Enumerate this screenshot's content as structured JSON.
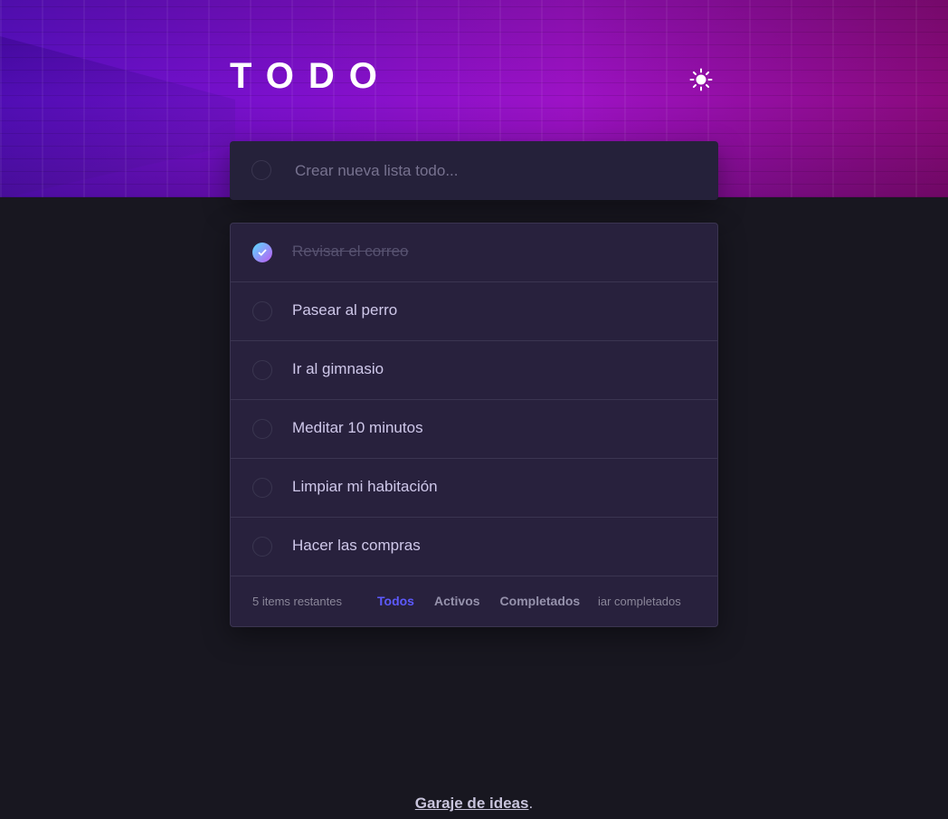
{
  "app": {
    "title": "TODO",
    "theme_icon": "sun-icon"
  },
  "new_todo": {
    "placeholder": "Crear nueva lista todo...",
    "value": ""
  },
  "todos": [
    {
      "label": "Revisar el correo",
      "completed": true
    },
    {
      "label": "Pasear al perro",
      "completed": false
    },
    {
      "label": "Ir al gimnasio",
      "completed": false
    },
    {
      "label": "Meditar 10 minutos",
      "completed": false
    },
    {
      "label": "Limpiar mi habitación",
      "completed": false
    },
    {
      "label": "Hacer las compras",
      "completed": false
    }
  ],
  "footer": {
    "items_left": "5 items restantes",
    "filters": [
      {
        "label": "Todos",
        "active": true
      },
      {
        "label": "Activos",
        "active": false
      },
      {
        "label": "Completados",
        "active": false
      }
    ],
    "clear_completed": "iar completados"
  },
  "credit": {
    "link_text": "Garaje de ideas",
    "suffix": "."
  },
  "colors": {
    "active_filter": "#5d5aff",
    "check_gradient_start": "#57ddff",
    "check_gradient_end": "#c058f3"
  }
}
